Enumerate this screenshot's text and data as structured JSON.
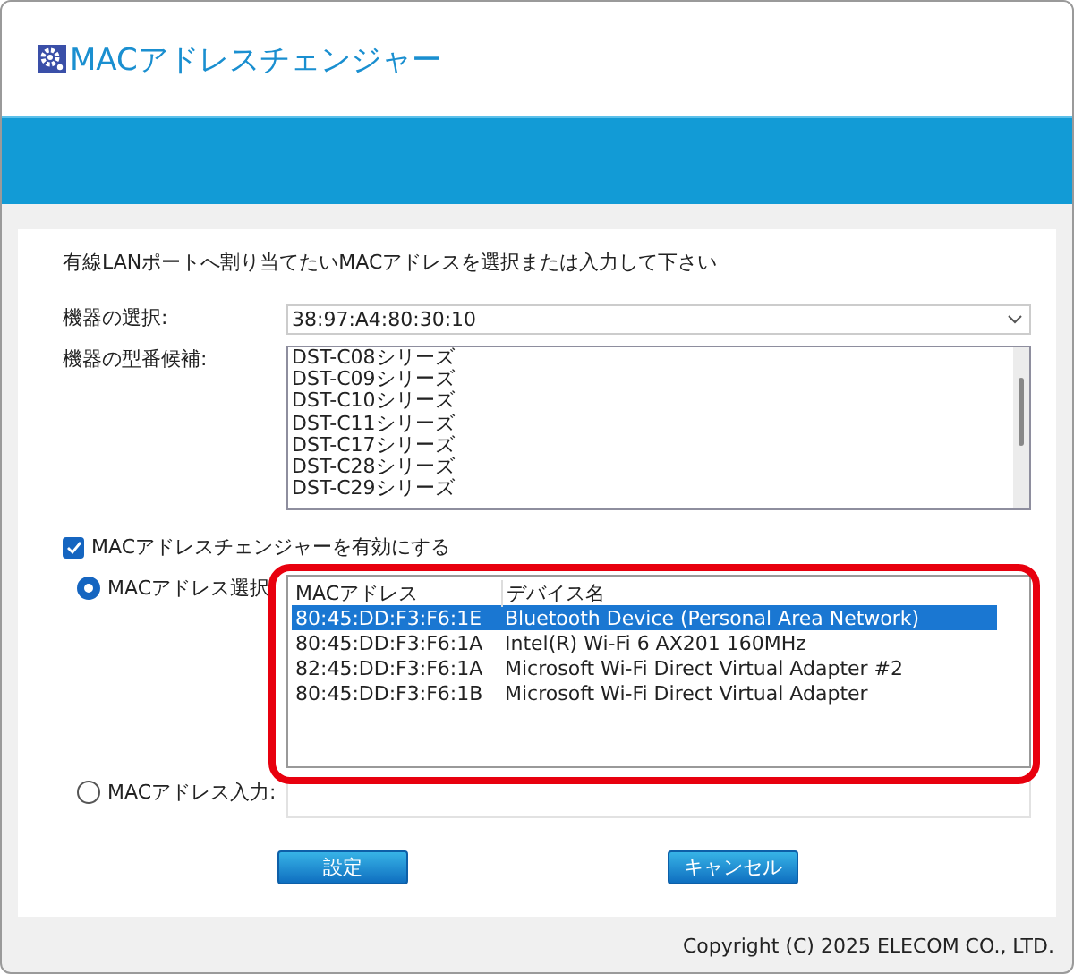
{
  "window": {
    "title": "MACアドレスチェンジャー"
  },
  "instruction": "有線LANポートへ割り当てたいMACアドレスを選択または入力して下さい",
  "device_select": {
    "label": "機器の選択:",
    "value": "38:97:A4:80:30:10"
  },
  "model_candidates": {
    "label": "機器の型番候補:",
    "items": [
      "DST-C08シリーズ",
      "DST-C09シリーズ",
      "DST-C10シリーズ",
      "DST-C11シリーズ",
      "DST-C17シリーズ",
      "DST-C28シリーズ",
      "DST-C29シリーズ"
    ]
  },
  "enable_checkbox": {
    "label": "MACアドレスチェンジャーを有効にする",
    "checked": true
  },
  "mode_options": [
    {
      "kind": "list",
      "label": "MACアドレス選択",
      "selected": true
    },
    {
      "kind": "input",
      "label": "MACアドレス入力:",
      "selected": false
    }
  ],
  "adapter_table": {
    "columns": [
      "MACアドレス",
      "デバイス名"
    ],
    "rows": [
      {
        "cells": [
          "80:45:DD:F3:F6:1E",
          "Bluetooth Device (Personal Area Network)"
        ],
        "selected": true
      },
      {
        "cells": [
          "80:45:DD:F3:F6:1A",
          "Intel(R) Wi-Fi 6 AX201 160MHz"
        ],
        "selected": false
      },
      {
        "cells": [
          "82:45:DD:F3:F6:1A",
          "Microsoft Wi-Fi Direct Virtual Adapter #2"
        ],
        "selected": false
      },
      {
        "cells": [
          "80:45:DD:F3:F6:1B",
          "Microsoft Wi-Fi Direct Virtual Adapter"
        ],
        "selected": false
      }
    ]
  },
  "buttons": [
    "設定",
    "キャンセル"
  ],
  "footer": "Copyright (C) 2025 ELECOM CO., LTD."
}
